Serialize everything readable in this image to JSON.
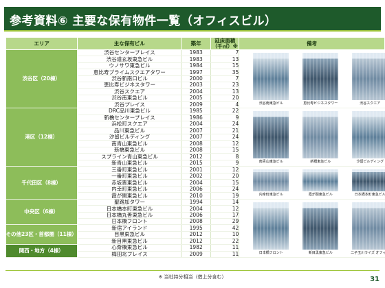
{
  "title": "参考資料⑥ 主要な保有物件一覧（オフィスビル）",
  "headers": {
    "area": "エリア",
    "property": "主な保有ビル",
    "year": "築年",
    "floor": "延床面積（千㎡）※",
    "remarks": "備考"
  },
  "groups": [
    {
      "area": "渋谷区（20棟）",
      "rows": [
        [
          "渋谷センタープレイス",
          "1983",
          "7"
        ],
        [
          "渋谷道玄坂東急ビル",
          "1983",
          "13"
        ],
        [
          "ウノサワ東急ビル",
          "1984",
          "15"
        ],
        [
          "恵比寿プライムスクエアタワー",
          "1997",
          "35"
        ],
        [
          "渋谷新南口ビル",
          "2000",
          "7"
        ],
        [
          "恵比寿ビジネスタワー",
          "2003",
          "23"
        ],
        [
          "渋谷スクエア",
          "2004",
          "13"
        ],
        [
          "渋谷南東急ビル",
          "2005",
          "20"
        ],
        [
          "渋谷プレイス",
          "2009",
          "4"
        ]
      ],
      "photos": [
        "渋谷南東急ビル",
        "恵比寿ビジネスタワー",
        "渋谷スクエア"
      ]
    },
    {
      "area": "港区（12棟）",
      "rows": [
        [
          "DRC品川東急ビル",
          "1985",
          "22"
        ],
        [
          "新橋センタープレイス",
          "1986",
          "9"
        ],
        [
          "浜松町スクエア",
          "2004",
          "24"
        ],
        [
          "品川東急ビル",
          "2007",
          "21"
        ],
        [
          "汐留ビルディング",
          "2007",
          "24"
        ],
        [
          "南青山東急ビル",
          "2008",
          "12"
        ],
        [
          "新橋東急ビル",
          "2008",
          "15"
        ],
        [
          "スプライン青山東急ビル",
          "2012",
          "8"
        ],
        [
          "新青山東急ビル",
          "2015",
          "9"
        ]
      ],
      "photos": [
        "南青山東急ビル",
        "新橋東急ビル",
        "汐留ビルディング"
      ]
    },
    {
      "area": "千代田区（8棟）",
      "rows": [
        [
          "三番町東急ビル",
          "2001",
          "12"
        ],
        [
          "一番町東急ビル",
          "2002",
          "20"
        ],
        [
          "赤坂晋東急ビル",
          "2004",
          "15"
        ],
        [
          "内幸町東急ビル",
          "2006",
          "24"
        ],
        [
          "霞が関東急ビル",
          "2010",
          "19"
        ]
      ],
      "photos": [
        "内幸町東急ビル",
        "霞が関東急ビル",
        "日本橋本町東急ビル"
      ]
    },
    {
      "area": "中央区（6棟）",
      "rows": [
        [
          "聖路加タワー",
          "1994",
          "14"
        ],
        [
          "日本橋本町東急ビル",
          "2004",
          "12"
        ],
        [
          "日本橋丸善東急ビル",
          "2006",
          "17"
        ],
        [
          "日本橋フロント",
          "2008",
          "29"
        ]
      ],
      "photos": [
        "日本橋フロント",
        "新目黒東急ビル",
        "二子玉川ライズ オフィス"
      ]
    },
    {
      "area": "その他23区・首都圏（11棟）",
      "rows": [
        [
          "新宿アイランド",
          "1995",
          "42"
        ],
        [
          "目黒東急ビル",
          "2012",
          "10"
        ],
        [
          "新目黒東急ビル",
          "2012",
          "22"
        ]
      ],
      "photos": []
    },
    {
      "area": "関西・地方（4棟）",
      "rows": [
        [
          "心斎橋東急ビル",
          "1982",
          "11"
        ],
        [
          "梅田北プレイス",
          "2009",
          "11"
        ]
      ],
      "photos": []
    }
  ],
  "footnote": "※ 当社持分相当（借上分含む）",
  "page_number": "31"
}
